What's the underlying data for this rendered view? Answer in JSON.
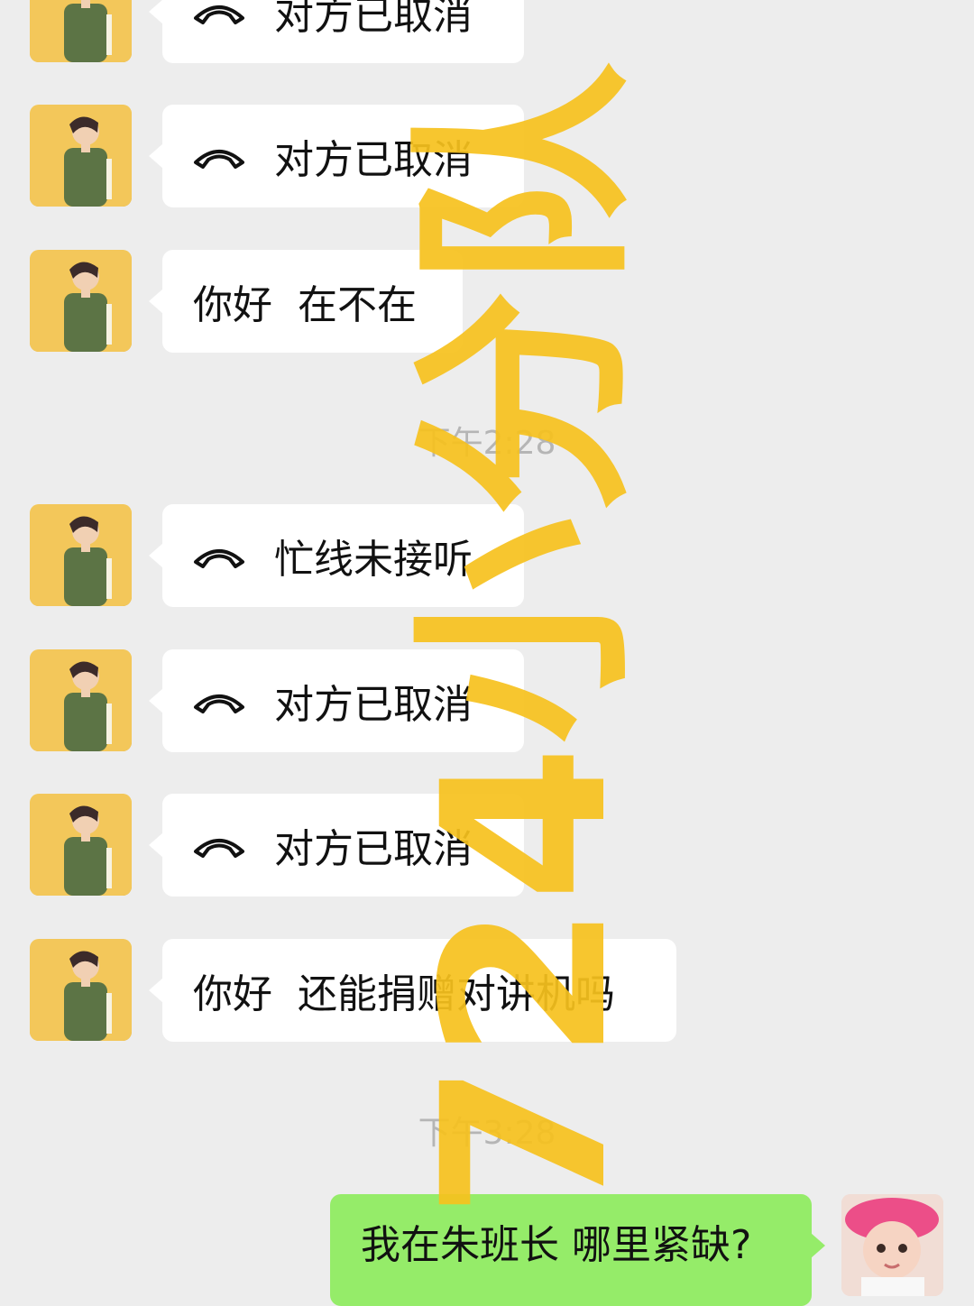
{
  "messages": [
    {
      "type": "call",
      "text": "对方已取消",
      "icon": "phone-hangup-icon"
    },
    {
      "type": "call",
      "text": "对方已取消",
      "icon": "phone-hangup-icon"
    },
    {
      "type": "text",
      "text": "你好  在不在"
    },
    {
      "type": "call",
      "text": "忙线未接听",
      "icon": "phone-hangup-icon"
    },
    {
      "type": "call",
      "text": "对方已取消",
      "icon": "phone-hangup-icon"
    },
    {
      "type": "call",
      "text": "对方已取消",
      "icon": "phone-hangup-icon"
    },
    {
      "type": "text",
      "text": "你好  还能捐赠对讲机吗"
    }
  ],
  "timestamps": [
    "下午2:28",
    "下午3:28"
  ],
  "my_message": {
    "text": "我在朱班长 哪里紧缺?"
  },
  "watermark": {
    "text": "724小分队",
    "color": "#f7c21e"
  },
  "colors": {
    "background": "#ededed",
    "incoming_bubble": "#ffffff",
    "outgoing_bubble": "#95ec69",
    "timestamp_text": "#b5b5b5"
  }
}
